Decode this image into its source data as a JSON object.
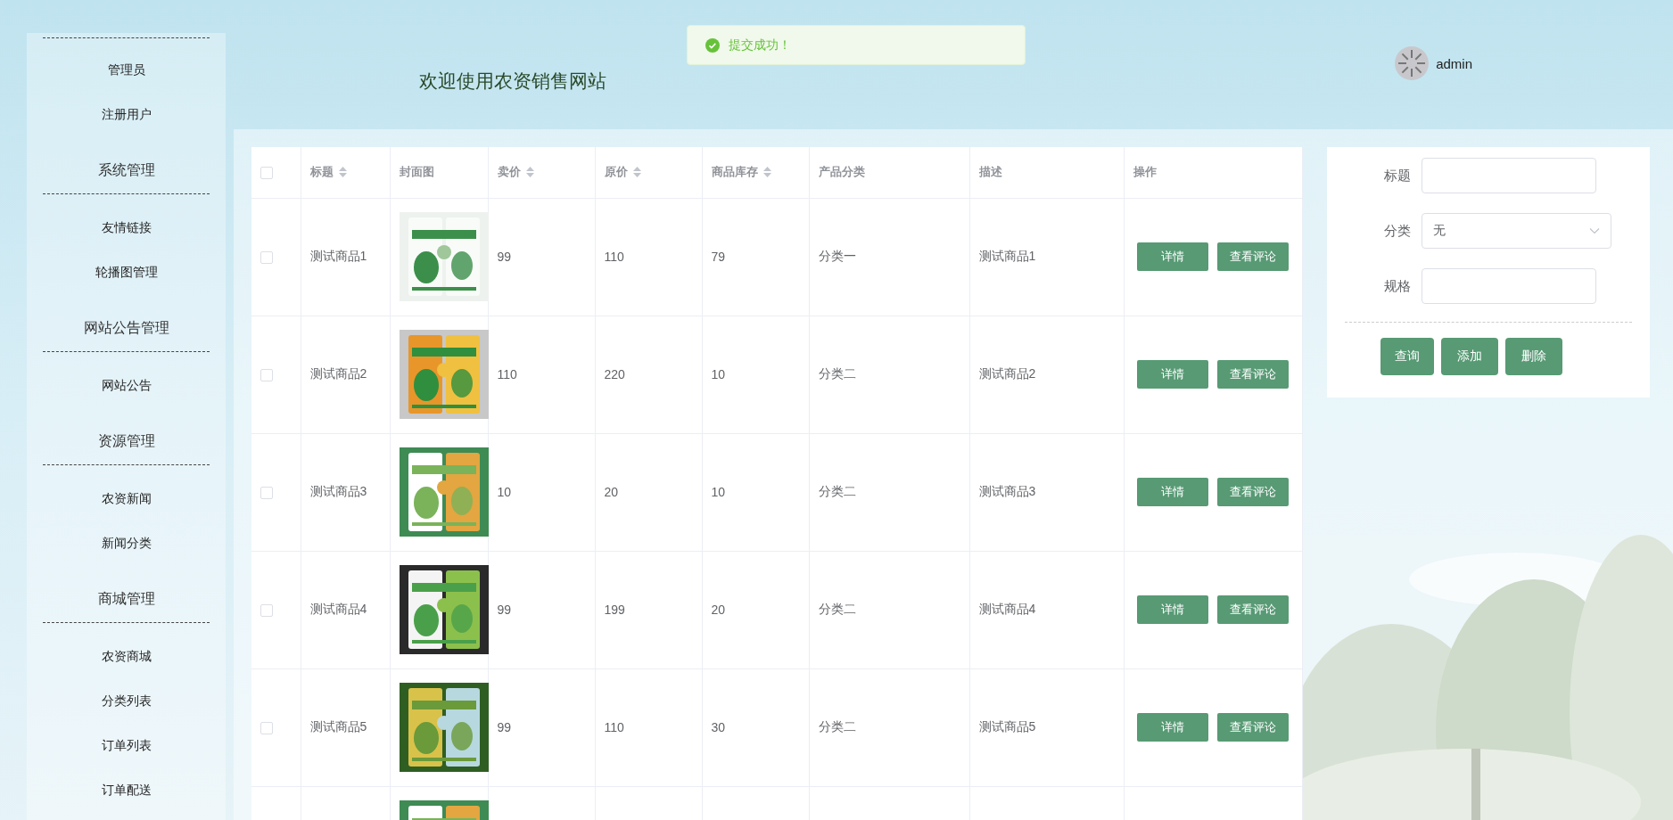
{
  "toast": {
    "text": "提交成功！"
  },
  "header": {
    "title": "欢迎使用农资销售网站"
  },
  "user": {
    "name": "admin"
  },
  "sidebar": {
    "groups": [
      {
        "items": [
          "管理员",
          "注册用户"
        ]
      },
      {
        "title": "系统管理",
        "items": [
          "友情链接",
          "轮播图管理"
        ]
      },
      {
        "title": "网站公告管理",
        "items": [
          "网站公告"
        ]
      },
      {
        "title": "资源管理",
        "items": [
          "农资新闻",
          "新闻分类"
        ]
      },
      {
        "title": "商城管理",
        "items": [
          "农资商城",
          "分类列表",
          "订单列表",
          "订单配送"
        ]
      }
    ]
  },
  "table": {
    "header_checked": false,
    "columns": [
      {
        "label": "标题",
        "sortable": true
      },
      {
        "label": "封面图",
        "sortable": false
      },
      {
        "label": "卖价",
        "sortable": true
      },
      {
        "label": "原价",
        "sortable": true
      },
      {
        "label": "商品库存",
        "sortable": true
      },
      {
        "label": "产品分类",
        "sortable": false
      },
      {
        "label": "描述",
        "sortable": false
      },
      {
        "label": "操作",
        "sortable": false
      }
    ],
    "rows": [
      {
        "checked": false,
        "title": "测试商品1",
        "cover": {
          "kind": "picture"
        },
        "price": "99",
        "original_price": "110",
        "stock": "79",
        "category": "分类一",
        "description": "测试商品1",
        "actions": [
          "详情",
          "查看评论"
        ]
      },
      {
        "checked": false,
        "title": "测试商品2",
        "cover": {
          "kind": "picture"
        },
        "price": "110",
        "original_price": "220",
        "stock": "10",
        "category": "分类二",
        "description": "测试商品2",
        "actions": [
          "详情",
          "查看评论"
        ]
      },
      {
        "checked": false,
        "title": "测试商品3",
        "cover": {
          "kind": "picture"
        },
        "price": "10",
        "original_price": "20",
        "stock": "10",
        "category": "分类二",
        "description": "测试商品3",
        "actions": [
          "详情",
          "查看评论"
        ]
      },
      {
        "checked": false,
        "title": "测试商品4",
        "cover": {
          "kind": "picture"
        },
        "price": "99",
        "original_price": "199",
        "stock": "20",
        "category": "分类二",
        "description": "测试商品4",
        "actions": [
          "详情",
          "查看评论"
        ]
      },
      {
        "checked": false,
        "title": "测试商品5",
        "cover": {
          "kind": "picture"
        },
        "price": "99",
        "original_price": "110",
        "stock": "30",
        "category": "分类二",
        "description": "测试商品5",
        "actions": [
          "详情",
          "查看评论"
        ]
      },
      {
        "cover": {
          "kind": "picture"
        }
      }
    ]
  },
  "form": {
    "fields": [
      {
        "kind": "input",
        "label": "标题"
      },
      {
        "kind": "select",
        "label": "分类",
        "value": "无"
      },
      {
        "kind": "input",
        "label": "规格"
      }
    ],
    "buttons": [
      "查询",
      "添加",
      "删除"
    ]
  }
}
